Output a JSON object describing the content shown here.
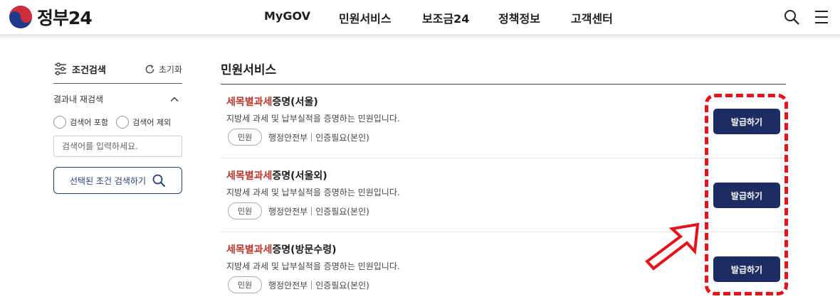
{
  "header": {
    "logo_text": "정부24",
    "nav": [
      {
        "label": "MyGOV"
      },
      {
        "label": "민원서비스"
      },
      {
        "label": "보조금24"
      },
      {
        "label": "정책정보"
      },
      {
        "label": "고객센터"
      }
    ]
  },
  "sidebar": {
    "title": "조건검색",
    "reset_label": "초기화",
    "refine_label": "결과내 재검색",
    "include_label": "검색어 포함",
    "exclude_label": "검색어 제외",
    "search_placeholder": "검색어를 입력하세요.",
    "search_button_label": "선택된 조건 검색하기"
  },
  "main": {
    "title": "민원서비스",
    "items": [
      {
        "title_highlight": "세목별과세",
        "title_rest": "증명(서울)",
        "description": "지방세 과세 및 납부실적을 증명하는 민원입니다.",
        "tag": "민원",
        "agency": "행정안전부",
        "auth": "인증필요(본인)",
        "button_label": "발급하기"
      },
      {
        "title_highlight": "세목별과세",
        "title_rest": "증명(서울외)",
        "description": "지방세 과세 및 납부실적을 증명하는 민원입니다.",
        "tag": "민원",
        "agency": "행정안전부",
        "auth": "인증필요(본인)",
        "button_label": "발급하기"
      },
      {
        "title_highlight": "세목별과세",
        "title_rest": "증명(방문수령)",
        "description": "지방세 과세 및 납부실적을 증명하는 민원입니다.",
        "tag": "민원",
        "agency": "행정안전부",
        "auth": "인증필요(본인)",
        "button_label": "발급하기"
      }
    ]
  },
  "colors": {
    "primary": "#1d2c63",
    "highlight": "#b7362c",
    "annotation": "#e2141c"
  },
  "icons": {
    "logo": "taegeuk-icon",
    "search": "search-icon",
    "menu": "menu-icon",
    "filter": "filter-sliders-icon",
    "reset": "refresh-icon",
    "collapse": "chevron-up-icon"
  }
}
